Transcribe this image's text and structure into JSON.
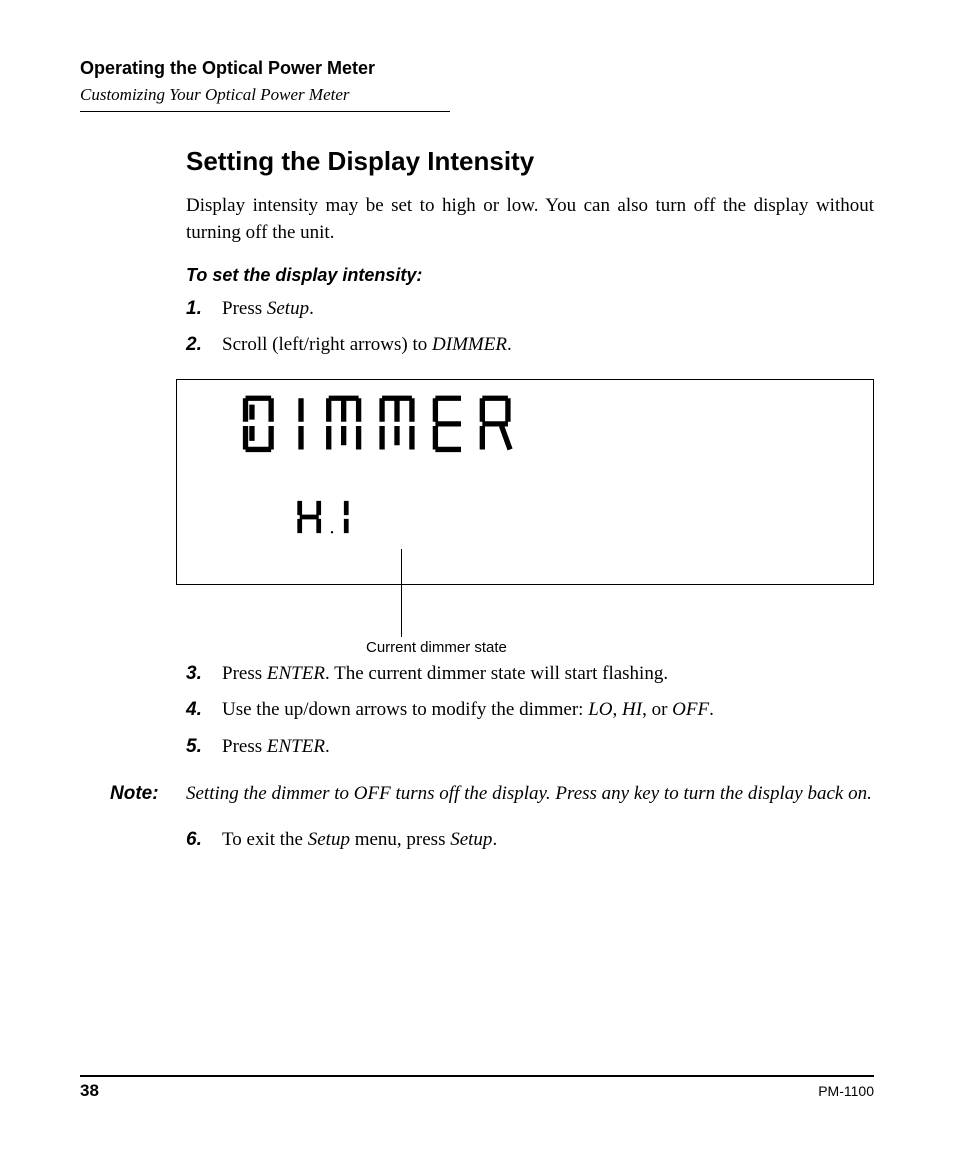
{
  "header": {
    "title": "Operating the Optical Power Meter",
    "subtitle": "Customizing Your Optical Power Meter"
  },
  "section": {
    "heading": "Setting the Display Intensity",
    "intro": "Display intensity may be set to high or low. You can also turn off the display without turning off the unit.",
    "procedure_head": "To set the display intensity:"
  },
  "steps_top": [
    {
      "pre": "Press ",
      "em": "Setup",
      "post": "."
    },
    {
      "pre": "Scroll (left/right arrows) to ",
      "em": "DIMMER",
      "post": "."
    }
  ],
  "lcd": {
    "line1": "DIMMER",
    "line2": "HI",
    "callout": "Current dimmer state"
  },
  "steps_mid": [
    {
      "pre": "Press ",
      "em1": "ENTER",
      "mid": ". The current dimmer state will start flashing.",
      "em2": "",
      "post": ""
    },
    {
      "pre": "Use the up/down arrows to modify the dimmer: ",
      "em1": "LO",
      "mid": ", ",
      "em2": "HI",
      "post_mid": ", or ",
      "em3": "OFF",
      "post": "."
    },
    {
      "pre": "Press ",
      "em1": "ENTER",
      "mid": ".",
      "em2": "",
      "post": ""
    }
  ],
  "note": {
    "label": "Note:",
    "text": "Setting the dimmer to OFF turns off the display. Press any key to turn the display back on."
  },
  "steps_last": [
    {
      "pre": "To exit the ",
      "em1": "Setup",
      "mid": " menu, press ",
      "em2": "Setup",
      "post": "."
    }
  ],
  "footer": {
    "page": "38",
    "model": "PM-1100"
  }
}
